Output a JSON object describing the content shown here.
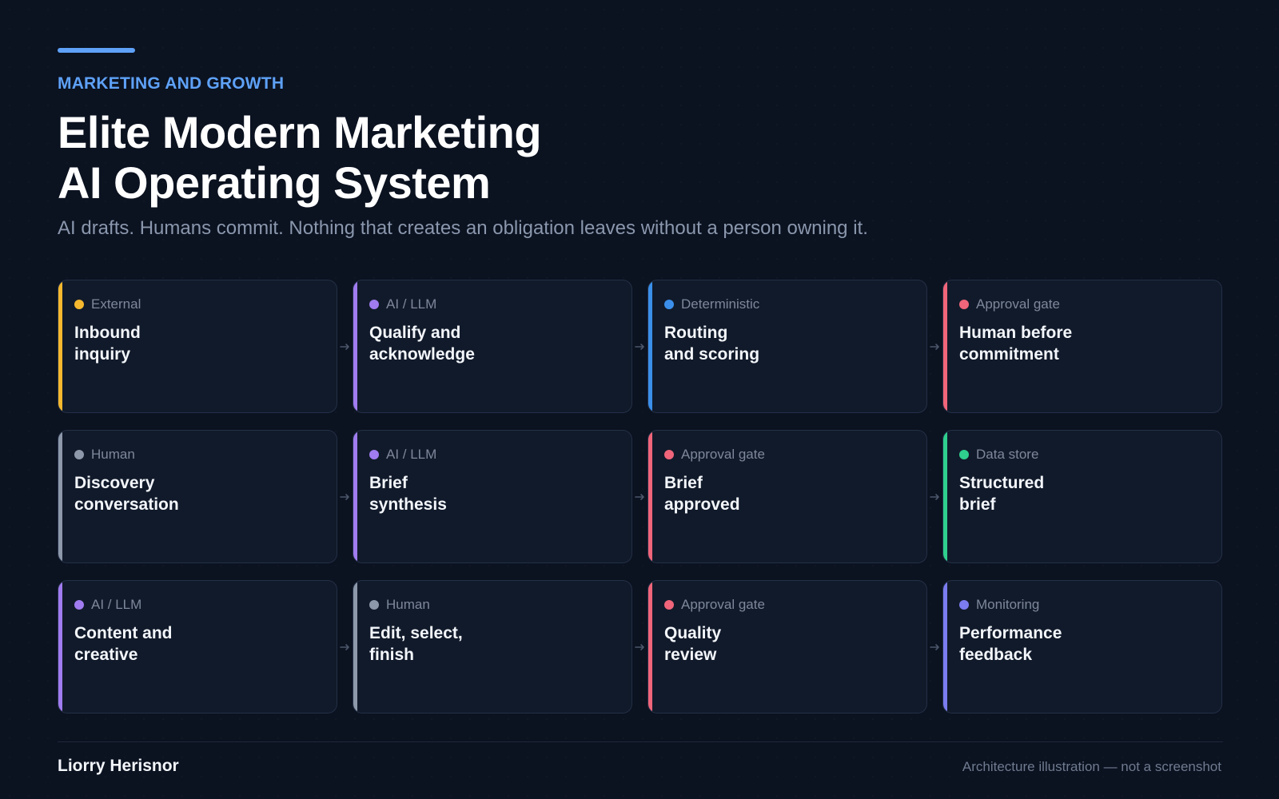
{
  "header": {
    "eyebrow": "MARKETING AND GROWTH",
    "title_lines": [
      "Elite Modern Marketing",
      "AI Operating System"
    ],
    "subtitle": "AI drafts. Humans commit. Nothing that creates an obligation leaves without a person owning it."
  },
  "colors": {
    "accent": "#5ea1f7",
    "external": "#f5b82e",
    "ai_llm": "#a07cf0",
    "deterministic": "#3b8fea",
    "approval_gate": "#f0657a",
    "human": "#8d98ab",
    "data_store": "#2fcf8e",
    "monitoring": "#7b7cf0",
    "arrow": "#4b566a"
  },
  "diagram": {
    "rows": [
      [
        {
          "kind": "External",
          "color_key": "external",
          "label_lines": [
            "Inbound",
            "inquiry"
          ]
        },
        {
          "kind": "AI / LLM",
          "color_key": "ai_llm",
          "label_lines": [
            "Qualify and",
            "acknowledge"
          ]
        },
        {
          "kind": "Deterministic",
          "color_key": "deterministic",
          "label_lines": [
            "Routing",
            "and scoring"
          ]
        },
        {
          "kind": "Approval gate",
          "color_key": "approval_gate",
          "label_lines": [
            "Human before",
            "commitment"
          ]
        }
      ],
      [
        {
          "kind": "Human",
          "color_key": "human",
          "label_lines": [
            "Discovery",
            "conversation"
          ]
        },
        {
          "kind": "AI / LLM",
          "color_key": "ai_llm",
          "label_lines": [
            "Brief",
            "synthesis"
          ]
        },
        {
          "kind": "Approval gate",
          "color_key": "approval_gate",
          "label_lines": [
            "Brief",
            "approved"
          ]
        },
        {
          "kind": "Data store",
          "color_key": "data_store",
          "label_lines": [
            "Structured",
            "brief"
          ]
        }
      ],
      [
        {
          "kind": "AI / LLM",
          "color_key": "ai_llm",
          "label_lines": [
            "Content and",
            "creative"
          ]
        },
        {
          "kind": "Human",
          "color_key": "human",
          "label_lines": [
            "Edit, select,",
            "finish"
          ]
        },
        {
          "kind": "Approval gate",
          "color_key": "approval_gate",
          "label_lines": [
            "Quality",
            "review"
          ]
        },
        {
          "kind": "Monitoring",
          "color_key": "monitoring",
          "label_lines": [
            "Performance",
            "feedback"
          ]
        }
      ]
    ]
  },
  "footer": {
    "author": "Liorry Herisnor",
    "disclaimer": "Architecture illustration — not a screenshot"
  }
}
